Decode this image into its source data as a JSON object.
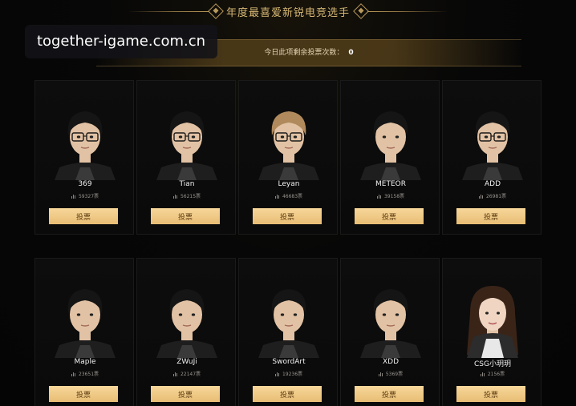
{
  "header": {
    "title": "年度最喜爱新锐电竞选手"
  },
  "watermark": {
    "text": "together-igame.com.cn"
  },
  "banner": {
    "label": "今日此项剩余投票次数：",
    "count": "0"
  },
  "players": [
    {
      "name": "369",
      "votes": "59327票",
      "button": "投票",
      "look": "glasses"
    },
    {
      "name": "Tian",
      "votes": "56215票",
      "button": "投票",
      "look": "glasses"
    },
    {
      "name": "Leyan",
      "votes": "46683票",
      "button": "投票",
      "look": "glasses-light"
    },
    {
      "name": "METEOR",
      "votes": "39158票",
      "button": "投票",
      "look": "plain"
    },
    {
      "name": "ADD",
      "votes": "26981票",
      "button": "投票",
      "look": "glasses"
    },
    {
      "name": "Maple",
      "votes": "23651票",
      "button": "投票",
      "look": "plain"
    },
    {
      "name": "ZWuJi",
      "votes": "22147票",
      "button": "投票",
      "look": "plain"
    },
    {
      "name": "SwordArt",
      "votes": "19236票",
      "button": "投票",
      "look": "plain"
    },
    {
      "name": "XDD",
      "votes": "5369票",
      "button": "投票",
      "look": "plain"
    },
    {
      "name": "CSG小玥玥",
      "votes": "2156票",
      "button": "投票",
      "look": "long-hair"
    }
  ],
  "colors": {
    "accent_gold": "#d6b774",
    "button_gold": "#f0c987",
    "button_text": "#5a3a10"
  }
}
